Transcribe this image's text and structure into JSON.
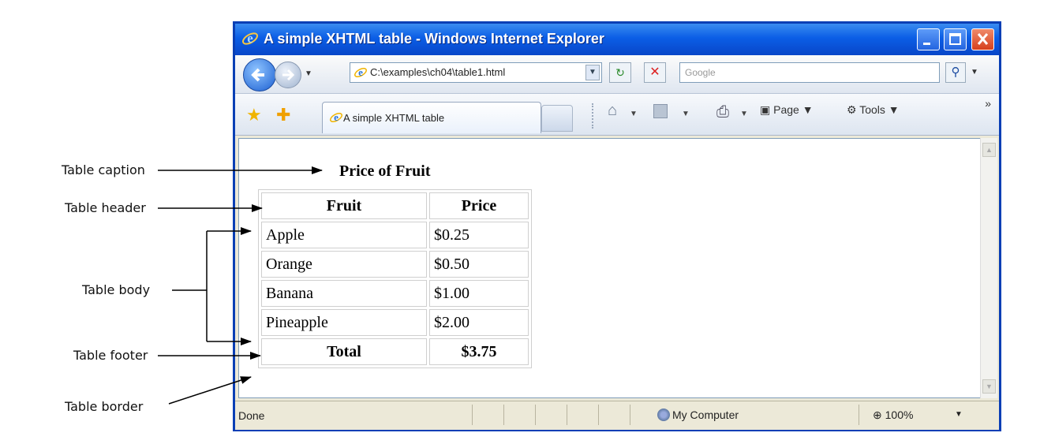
{
  "window": {
    "title": "A simple XHTML table - Windows Internet Explorer"
  },
  "navbar": {
    "address_url": "C:\\examples\\ch04\\table1.html",
    "search_placeholder": "Google"
  },
  "tabbar": {
    "tab_label": "A simple XHTML table",
    "page_menu": "Page",
    "tools_menu": "Tools"
  },
  "content": {
    "caption": "Price of Fruit",
    "header": [
      "Fruit",
      "Price"
    ],
    "rows": [
      [
        "Apple",
        "$0.25"
      ],
      [
        "Orange",
        "$0.50"
      ],
      [
        "Banana",
        "$1.00"
      ],
      [
        "Pineapple",
        "$2.00"
      ]
    ],
    "footer": [
      "Total",
      "$3.75"
    ]
  },
  "statusbar": {
    "status": "Done",
    "zone": "My Computer",
    "zoom": "100%"
  },
  "callouts": {
    "caption": "Table caption",
    "header": "Table header",
    "body": "Table body",
    "footer": "Table footer",
    "border": "Table border"
  },
  "colors": {
    "titlebar": "#0b5ee6",
    "window_border": "#0a3fb5",
    "close_button": "#d6401c"
  }
}
